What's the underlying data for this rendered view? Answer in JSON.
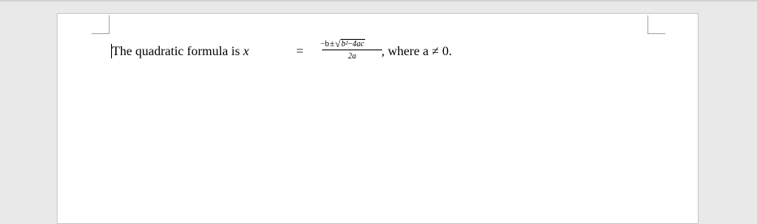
{
  "paragraph": {
    "text_before": "The quadratic formula is ",
    "variable": "x",
    "equals": "=",
    "numerator": {
      "neg_b": "−b",
      "plus_minus": "±",
      "sqrt_symbol": "√",
      "b_squared": "b²",
      "minus": "−",
      "four_ac": "4ac"
    },
    "denominator": "2a",
    "text_after": ", where a ≠ 0."
  }
}
